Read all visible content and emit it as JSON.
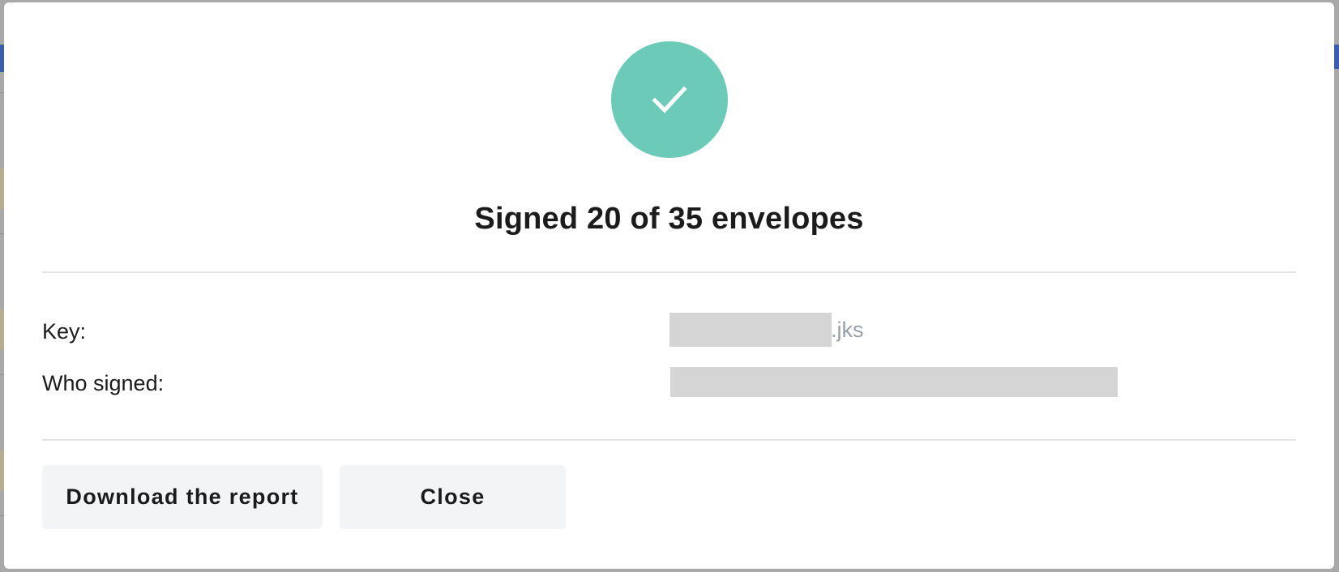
{
  "dialog": {
    "status_icon": "checkmark-icon",
    "title": "Signed 20 of 35 envelopes",
    "colors": {
      "success": "#6ccbb8",
      "button_bg": "#f3f4f6",
      "divider": "#e3e4e6",
      "muted_text": "#9aa0a6"
    },
    "details": {
      "key_label": "Key:",
      "key_value_suffix": ".jks",
      "who_signed_label": "Who signed:"
    },
    "buttons": {
      "download_label": "Download the report",
      "close_label": "Close"
    }
  }
}
